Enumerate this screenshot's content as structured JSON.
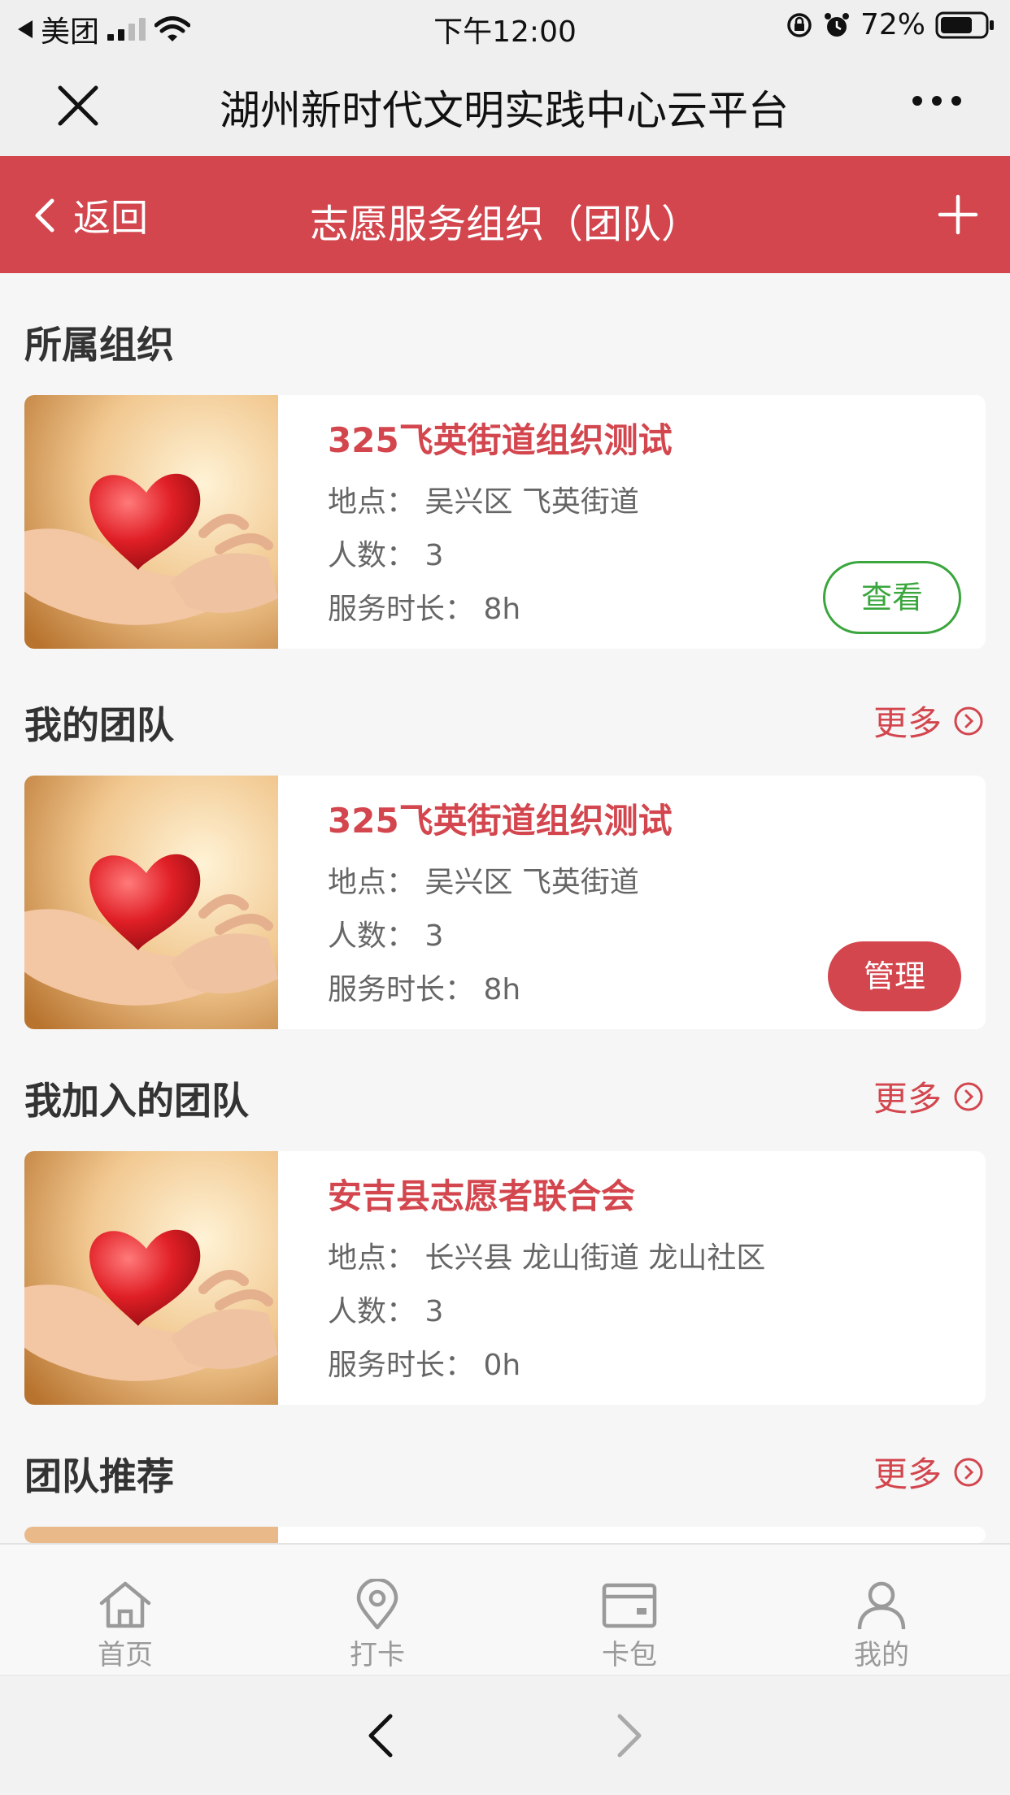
{
  "status": {
    "carrier": "美团",
    "time": "下午12:00",
    "battery": "72%"
  },
  "wechat": {
    "title": "湖州新时代文明实践中心云平台"
  },
  "header": {
    "back_label": "返回",
    "title": "志愿服务组织（团队）"
  },
  "sections": {
    "org": {
      "title": "所属组织"
    },
    "my_team": {
      "title": "我的团队",
      "more": "更多"
    },
    "joined": {
      "title": "我加入的团队",
      "more": "更多"
    },
    "recommend": {
      "title": "团队推荐",
      "more": "更多"
    }
  },
  "cards": {
    "org": {
      "name": "325飞英街道组织测试",
      "location": "地点：  吴兴区 飞英街道",
      "members": "人数：  3",
      "hours": "服务时长：  8h",
      "action": "查看"
    },
    "my_team": {
      "name": "325飞英街道组织测试",
      "location": "地点：  吴兴区 飞英街道",
      "members": "人数：  3",
      "hours": "服务时长：  8h",
      "action": "管理"
    },
    "joined": {
      "name": "安吉县志愿者联合会",
      "location": "地点：  长兴县 龙山街道 龙山社区",
      "members": "人数：  3",
      "hours": "服务时长：  0h"
    }
  },
  "tabs": [
    {
      "label": "首页",
      "icon": "home-icon"
    },
    {
      "label": "打卡",
      "icon": "location-pin-icon"
    },
    {
      "label": "卡包",
      "icon": "wallet-icon"
    },
    {
      "label": "我的",
      "icon": "person-icon"
    }
  ],
  "colors": {
    "brand_red": "#d3464e",
    "view_green": "#3aa63d"
  }
}
